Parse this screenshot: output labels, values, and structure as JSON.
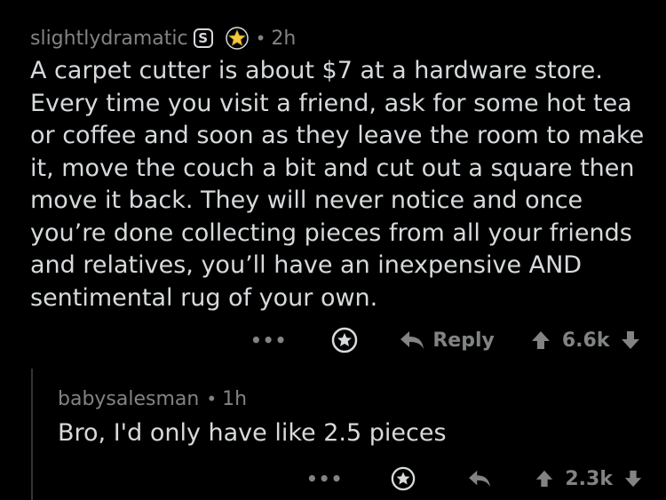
{
  "parent": {
    "username": "slightlydramatic",
    "mod_badge": "S",
    "separator": "•",
    "time": "2h",
    "body": "A carpet cutter is about $7 at a hardware store. Every time you visit a friend, ask for some hot tea or coffee and soon as they leave the room to make it, move the couch a bit and cut out a square then move it back. They will never notice and once you’re done collecting pieces from all your friends and relatives, you’ll have an inexpensive AND sentimental rug of your own.",
    "more_label": "•••",
    "reply_label": "Reply",
    "score": "6.6k"
  },
  "reply": {
    "username": "babysalesman",
    "separator": "•",
    "time": "1h",
    "body": "Bro, I'd only have like 2.5 pieces",
    "more_label": "•••",
    "score": "2.3k"
  },
  "colors": {
    "background": "#000000",
    "text": "#d7dadc",
    "meta": "#818384",
    "award_gold": "#f5c940",
    "thread_line": "#343536"
  }
}
